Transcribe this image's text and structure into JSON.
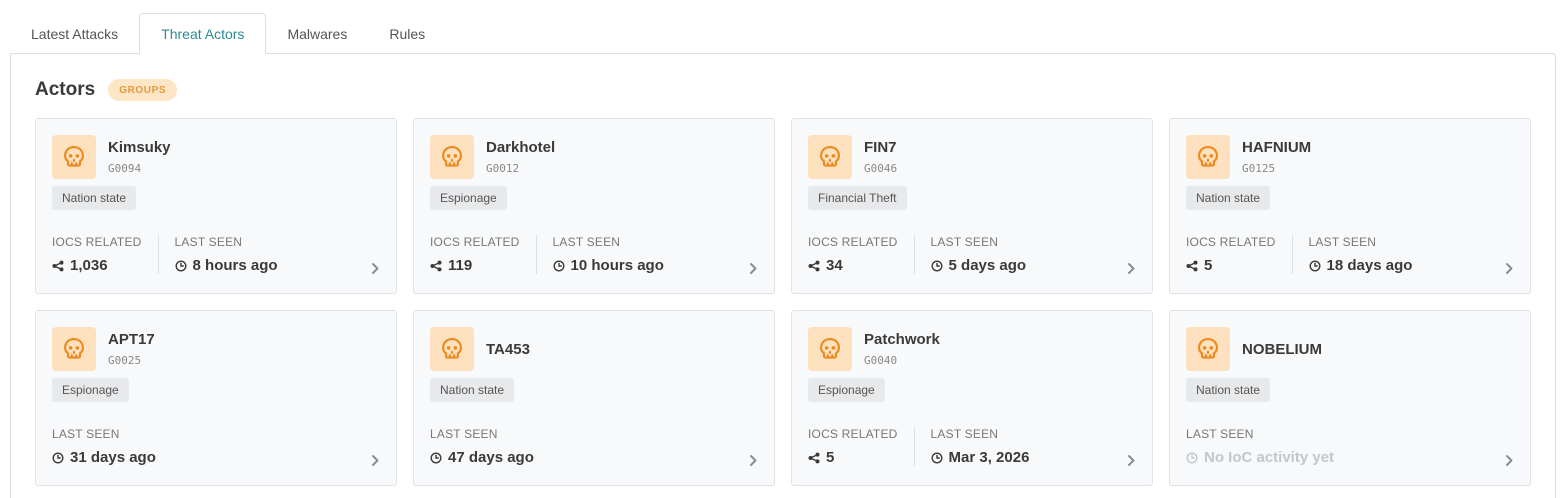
{
  "tabs": [
    {
      "label": "Latest Attacks",
      "active": false
    },
    {
      "label": "Threat Actors",
      "active": true
    },
    {
      "label": "Malwares",
      "active": false
    },
    {
      "label": "Rules",
      "active": false
    }
  ],
  "section": {
    "title": "Actors",
    "badge": "GROUPS"
  },
  "labels": {
    "iocs_related": "IOCS RELATED",
    "last_seen": "LAST SEEN"
  },
  "icons": {
    "avatar": "skull-icon",
    "iocs": "share-icon",
    "last_seen": "clock-icon",
    "open": "chevron-right-icon"
  },
  "colors": {
    "accent": "#2e8a94",
    "badge_bg": "#fde6c6",
    "badge_text": "#e79a3a",
    "avatar_bg": "#fde1bf",
    "skull": "#ec8a1e"
  },
  "actors": [
    {
      "name": "Kimsuky",
      "id": "G0094",
      "tag": "Nation state",
      "iocs": "1,036",
      "last_seen": "8 hours ago"
    },
    {
      "name": "Darkhotel",
      "id": "G0012",
      "tag": "Espionage",
      "iocs": "119",
      "last_seen": "10 hours ago"
    },
    {
      "name": "FIN7",
      "id": "G0046",
      "tag": "Financial Theft",
      "iocs": "34",
      "last_seen": "5 days ago"
    },
    {
      "name": "HAFNIUM",
      "id": "G0125",
      "tag": "Nation state",
      "iocs": "5",
      "last_seen": "18 days ago"
    },
    {
      "name": "APT17",
      "id": "G0025",
      "tag": "Espionage",
      "iocs": null,
      "last_seen": "31 days ago"
    },
    {
      "name": "TA453",
      "id": null,
      "tag": "Nation state",
      "iocs": null,
      "last_seen": "47 days ago"
    },
    {
      "name": "Patchwork",
      "id": "G0040",
      "tag": "Espionage",
      "iocs": "5",
      "last_seen": "Mar 3, 2026"
    },
    {
      "name": "NOBELIUM",
      "id": null,
      "tag": "Nation state",
      "iocs": null,
      "last_seen": "No IoC activity yet",
      "muted": true
    }
  ]
}
